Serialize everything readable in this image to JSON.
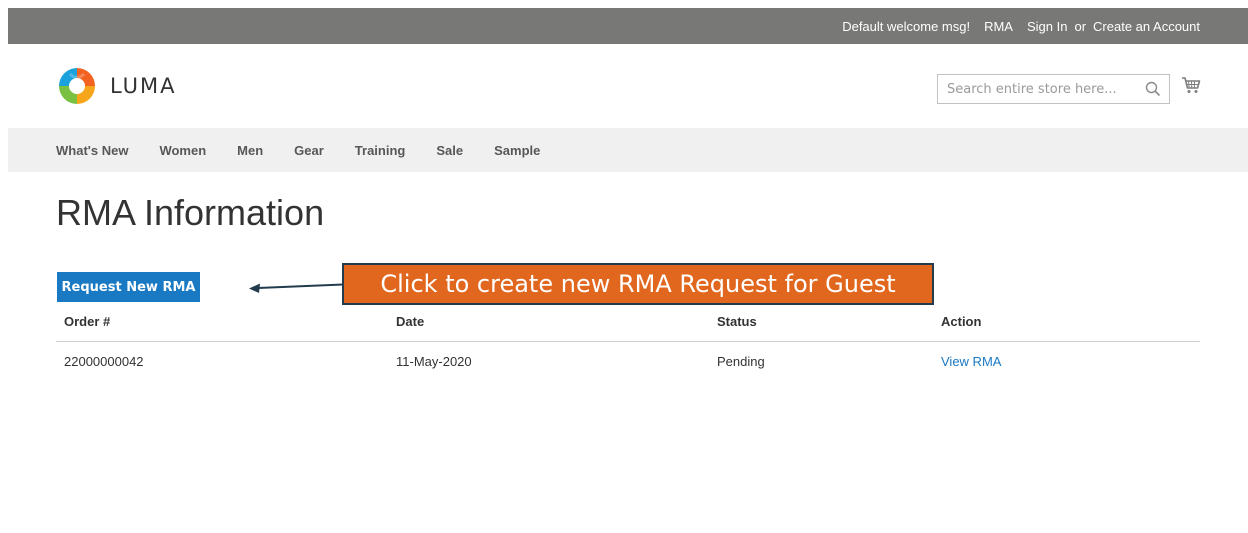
{
  "header": {
    "welcome": "Default welcome msg!",
    "rma_link": "RMA",
    "sign_in": "Sign In",
    "or": "or",
    "create_account": "Create an Account"
  },
  "brand": {
    "name": "LUMA",
    "colors": [
      "#f26322",
      "#f7a51b",
      "#7ac142",
      "#1ba1dc"
    ]
  },
  "search": {
    "placeholder": "Search entire store here...",
    "value": ""
  },
  "nav": {
    "items": [
      "What's New",
      "Women",
      "Men",
      "Gear",
      "Training",
      "Sale",
      "Sample"
    ]
  },
  "page": {
    "title": "RMA Information",
    "request_button": "Request New RMA",
    "callout": "Click to create new RMA Request for Guest"
  },
  "table": {
    "headers": [
      "Order #",
      "Date",
      "Status",
      "Action"
    ],
    "rows": [
      {
        "order": "22000000042",
        "date": "11-May-2020",
        "status": "Pending",
        "action": "View RMA"
      }
    ]
  },
  "colors": {
    "top_bar": "#787876",
    "nav_bar": "#f0f0f0",
    "primary_button": "#1979c3",
    "link": "#1979c3",
    "callout_bg": "#e1671f",
    "callout_border": "#233c4d"
  },
  "icons": {
    "search": "search-icon",
    "cart": "cart-icon",
    "logo": "luma-logo-icon",
    "arrow": "arrow-left-icon"
  }
}
